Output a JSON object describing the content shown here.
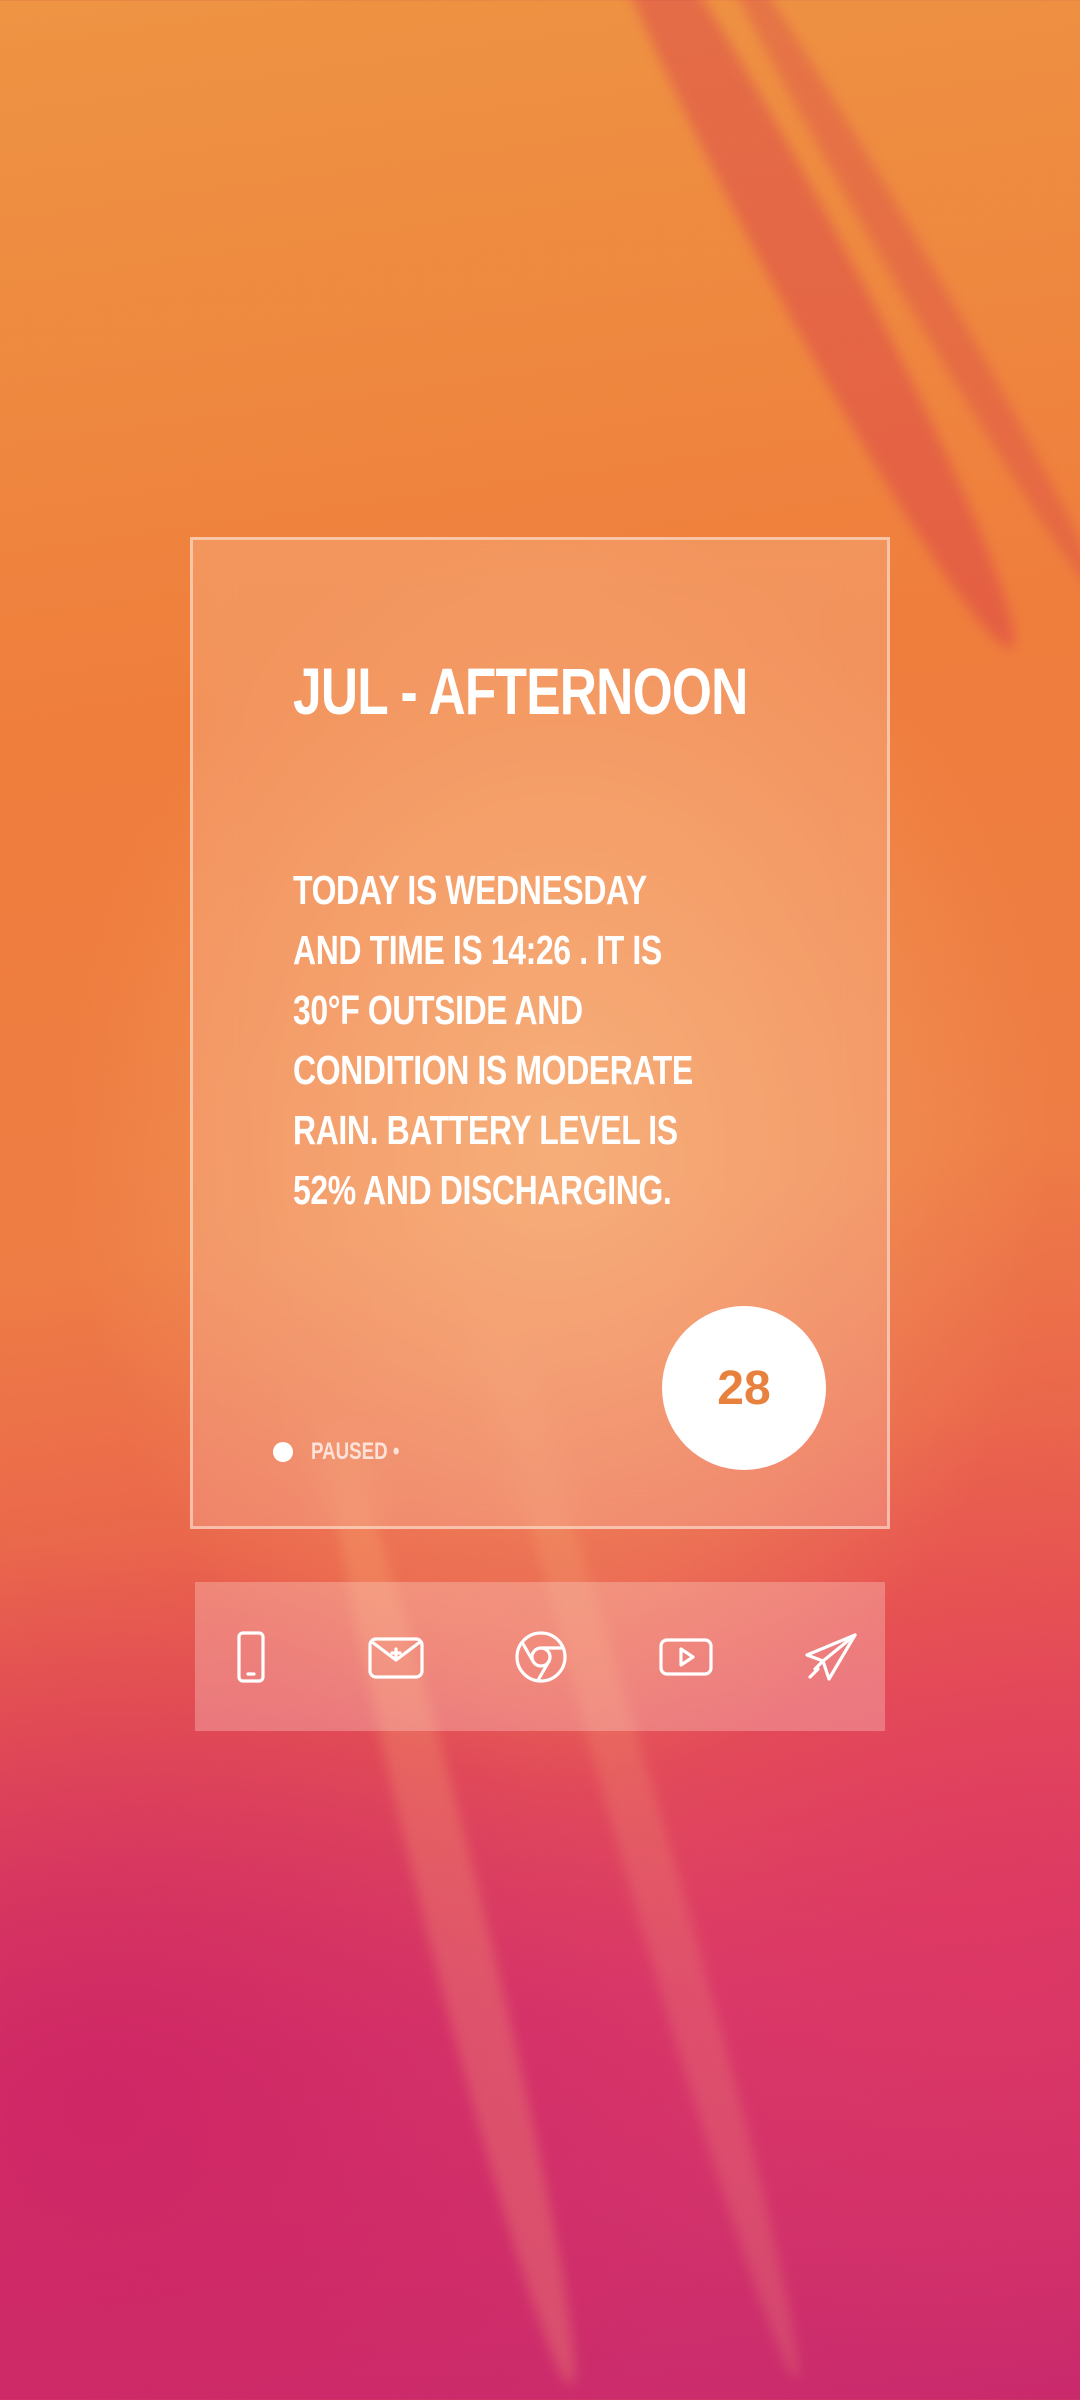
{
  "widget": {
    "title": "JUL -  AFTERNOON",
    "description": "TODAY IS WEDNESDAY AND TIME IS 14:26 . IT IS 30°F OUTSIDE AND CONDITION IS MODERATE RAIN. BATTERY LEVEL IS 52% AND DISCHARGING.",
    "media_status": "PAUSED •",
    "day_of_month": "28",
    "accent_color": "#e8803e"
  },
  "dock": {
    "apps": [
      {
        "icon": "phone-icon"
      },
      {
        "icon": "email-icon"
      },
      {
        "icon": "chrome-icon"
      },
      {
        "icon": "youtube-icon"
      },
      {
        "icon": "telegram-icon"
      }
    ]
  }
}
